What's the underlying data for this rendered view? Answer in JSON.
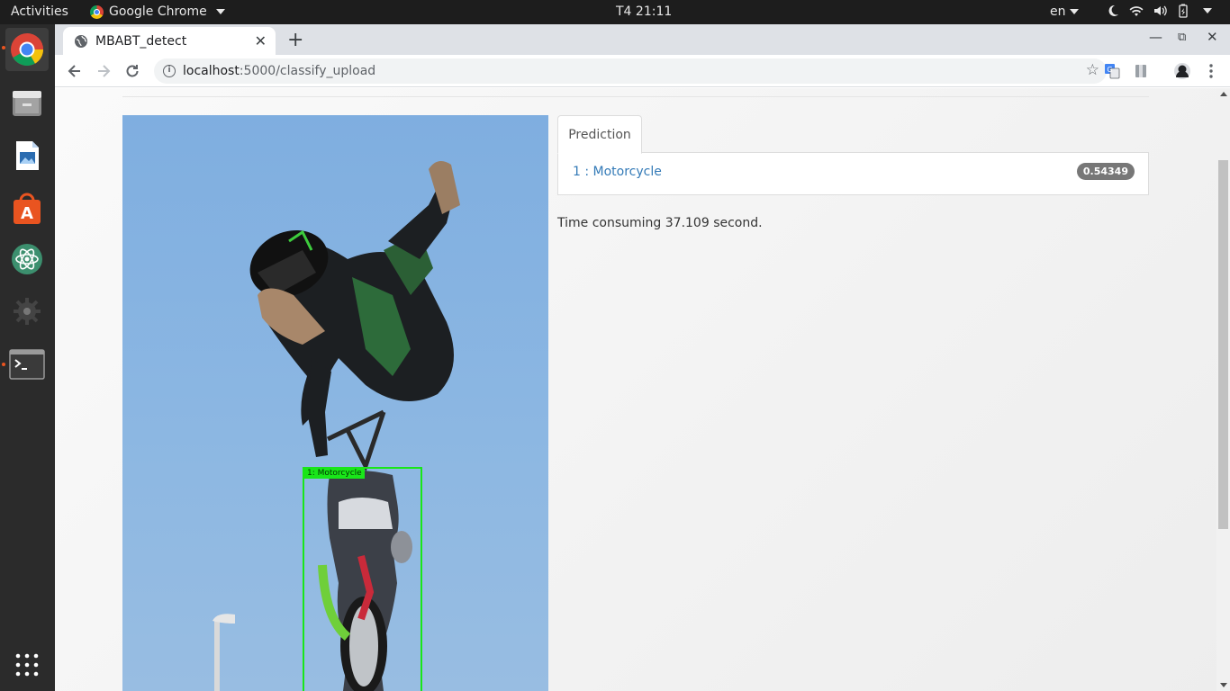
{
  "topbar": {
    "activities": "Activities",
    "app_name": "Google Chrome",
    "clock": "T4 21:11",
    "language": "en"
  },
  "dock": {
    "items": [
      {
        "name": "chrome",
        "icon": "chrome-icon",
        "running": true
      },
      {
        "name": "files",
        "icon": "files-icon",
        "running": false
      },
      {
        "name": "writer",
        "icon": "writer-icon",
        "running": false
      },
      {
        "name": "software",
        "icon": "software-center-icon",
        "running": false
      },
      {
        "name": "atom",
        "icon": "atom-icon",
        "running": false
      },
      {
        "name": "settings",
        "icon": "gear-icon",
        "running": false
      },
      {
        "name": "terminal",
        "icon": "terminal-icon",
        "running": true
      }
    ],
    "apps_grid_icon": "apps-grid-icon"
  },
  "browser": {
    "tab_title": "MBABT_detect",
    "url_host": "localhost",
    "url_path": ":5000/classify_upload"
  },
  "page": {
    "detection_label": "1: Motorcycle",
    "prediction_tab": "Prediction",
    "prediction_item": "1 : Motorcycle",
    "prediction_score": "0.54349",
    "time_text": "Time consuming 37.109 second."
  },
  "colors": {
    "detect_box": "#19e619",
    "link": "#337ab7",
    "badge": "#777777",
    "accent_dot": "#e95420"
  }
}
